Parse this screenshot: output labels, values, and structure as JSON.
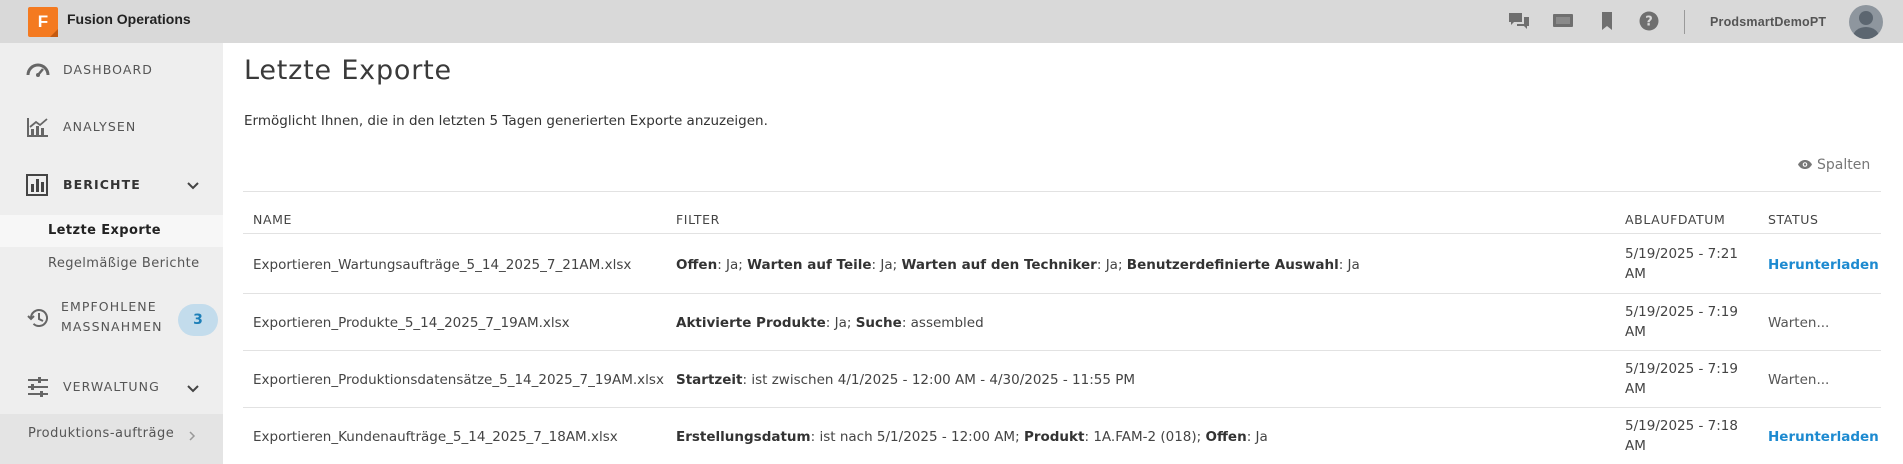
{
  "app": {
    "logo_letter": "F",
    "title": "Fusion Operations",
    "username": "ProdsmartDemoPT",
    "colors": {
      "accent": "#f47a20",
      "link": "#1d8ad0",
      "badge_bg": "#c3dcec"
    }
  },
  "topbar_icons": [
    "chat-icon",
    "screen-icon",
    "bookmark-icon",
    "help-icon"
  ],
  "sidebar": {
    "items": [
      {
        "label": "DASHBOARD",
        "icon": "gauge-icon"
      },
      {
        "label": "ANALYSEN",
        "icon": "chart-icon"
      },
      {
        "label": "BERICHTE",
        "icon": "report-icon"
      },
      {
        "label_line1": "EMPFOHLENE",
        "label_line2": "MASSNAHMEN",
        "icon": "history-icon",
        "badge": "3"
      },
      {
        "label": "VERWALTUNG",
        "icon": "sliders-icon"
      }
    ],
    "sub_items": [
      {
        "label": "Letzte Exporte"
      },
      {
        "label": "Regelmäßige Berichte"
      }
    ],
    "bottom_item": {
      "label": "Produktions-aufträge"
    }
  },
  "main": {
    "title": "Letzte Exporte",
    "description": "Ermöglicht Ihnen, die in den letzten 5 Tagen generierten Exporte anzuzeigen.",
    "columns_button": "Spalten",
    "table": {
      "headers": [
        "NAME",
        "FILTER",
        "ABLAUFDATUM",
        "STATUS"
      ],
      "rows": [
        {
          "name": "Exportieren_Wartungsaufträge_5_14_2025_7_21AM.xlsx",
          "filters": [
            {
              "key": "Offen",
              "value": "Ja"
            },
            {
              "key": "Warten auf Teile",
              "value": "Ja"
            },
            {
              "key": "Warten auf den Techniker",
              "value": "Ja"
            },
            {
              "key": "Benutzerdefinierte Auswahl",
              "value": "Ja"
            }
          ],
          "date_line1": "5/19/2025 - 7:21",
          "date_line2": "AM",
          "status": "Herunterladen",
          "status_type": "link"
        },
        {
          "name": "Exportieren_Produkte_5_14_2025_7_19AM.xlsx",
          "filters": [
            {
              "key": "Aktivierte Produkte",
              "value": "Ja"
            },
            {
              "key": "Suche",
              "value": "assembled"
            }
          ],
          "date_line1": "5/19/2025 - 7:19",
          "date_line2": "AM",
          "status": "Warten...",
          "status_type": "wait"
        },
        {
          "name": "Exportieren_Produktionsdatensätze_5_14_2025_7_19AM.xlsx",
          "filters": [
            {
              "key": "Startzeit",
              "value": "ist zwischen 4/1/2025 - 12:00 AM - 4/30/2025 - 11:55 PM"
            }
          ],
          "date_line1": "5/19/2025 - 7:19",
          "date_line2": "AM",
          "status": "Warten...",
          "status_type": "wait"
        },
        {
          "name": "Exportieren_Kundenaufträge_5_14_2025_7_18AM.xlsx",
          "filters": [
            {
              "key": "Erstellungsdatum",
              "value": "ist nach 5/1/2025 - 12:00 AM"
            },
            {
              "key": "Produkt",
              "value": "1A.FAM-2 (018)"
            },
            {
              "key": "Offen",
              "value": "Ja"
            }
          ],
          "date_line1": "5/19/2025 - 7:18",
          "date_line2": "AM",
          "status": "Herunterladen",
          "status_type": "link"
        }
      ]
    }
  }
}
